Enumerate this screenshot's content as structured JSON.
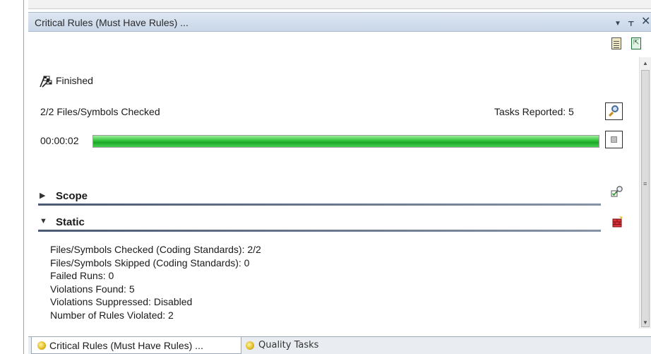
{
  "panel": {
    "title": "Critical Rules (Must Have Rules) ...",
    "buttons": {
      "dropdown": "▼",
      "pin": "ᚁ",
      "close": "✕"
    }
  },
  "toolbar": {
    "icons": [
      "report-icon",
      "export-icon"
    ]
  },
  "status": {
    "state": "Finished",
    "checked": "2/2 Files/Symbols Checked",
    "tasks": "Tasks Reported: 5",
    "elapsed": "00:00:02",
    "progress": 1.0
  },
  "sections": {
    "scope": {
      "label": "Scope",
      "arrow": "▶"
    },
    "static": {
      "label": "Static",
      "arrow": "▼"
    }
  },
  "stats": [
    "Files/Symbols Checked (Coding Standards): 2/2",
    "Files/Symbols Skipped (Coding Standards): 0",
    "Failed Runs: 0",
    "Violations Found: 5",
    "Violations Suppressed: Disabled",
    "Number of Rules Violated: 2"
  ],
  "tabs": [
    {
      "label": "Critical Rules (Must Have Rules) ...",
      "active": true
    },
    {
      "label": "Quality Tasks",
      "active": false
    }
  ],
  "colors": {
    "progress_green": "#2fc43a",
    "header_blue": "#c9d7e9",
    "section_line": "#4a5a73"
  }
}
